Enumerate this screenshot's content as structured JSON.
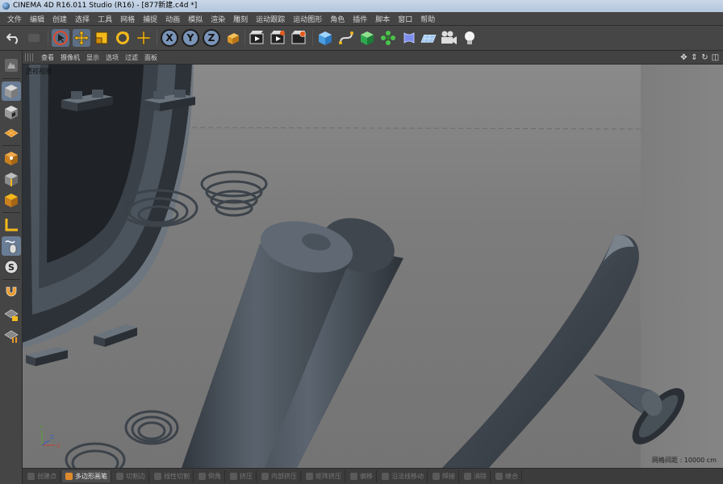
{
  "window": {
    "title": "CINEMA 4D R16.011 Studio (R16) - [877新建.c4d *]"
  },
  "menu": [
    "文件",
    "编辑",
    "创建",
    "选择",
    "工具",
    "网格",
    "捕捉",
    "动画",
    "模拟",
    "渲染",
    "雕刻",
    "运动跟踪",
    "运动图形",
    "角色",
    "插件",
    "脚本",
    "窗口",
    "帮助"
  ],
  "toolbar": {
    "icons": [
      "undo-icon",
      "redo-icon",
      "live-select-icon",
      "move-icon",
      "scale-icon",
      "rotate-icon",
      "last-tool-icon",
      "x-axis-lock-icon",
      "y-axis-lock-icon",
      "z-axis-lock-icon",
      "coordinate-system-icon",
      "render-view-icon",
      "render-to-picture-viewer-icon",
      "edit-render-settings-icon",
      "cube-object-icon",
      "spline-icon",
      "nurbs-icon",
      "array-icon",
      "deformer-icon",
      "floor-icon",
      "camera-icon",
      "light-icon"
    ],
    "axis_x": "X",
    "axis_y": "Y",
    "axis_z": "Z"
  },
  "left_tools": [
    "make-editable-icon",
    "model-mode-icon",
    "texture-mode-icon",
    "workplane-icon",
    "points-mode-icon",
    "edges-mode-icon",
    "polygons-mode-icon",
    "enable-axis-icon",
    "tweak-mode-icon",
    "solo-icon",
    "snap-icon",
    "lock-workplane-icon",
    "planar-workplane-icon"
  ],
  "viewport": {
    "menu": [
      "查看",
      "摄像机",
      "显示",
      "选项",
      "过滤",
      "面板"
    ],
    "nav_icons": [
      "pan-icon",
      "dolly-icon",
      "rotate-view-icon",
      "toggle-views-icon"
    ],
    "label": "透视视图",
    "grid_info": "网格间距 : 10000 cm",
    "axis_labels": {
      "x": "X",
      "y": "Y",
      "z": "Z"
    }
  },
  "bottom_tools": [
    {
      "label": "创建点",
      "active": false
    },
    {
      "label": "多边形画笔",
      "active": true
    },
    {
      "label": "切割边",
      "active": false
    },
    {
      "label": "线性切割",
      "active": false
    },
    {
      "label": "倒角",
      "active": false
    },
    {
      "label": "挤压",
      "active": false
    },
    {
      "label": "内部挤压",
      "active": false
    },
    {
      "label": "矩阵挤压",
      "active": false
    },
    {
      "label": "偏移",
      "active": false
    },
    {
      "label": "沿法线移动",
      "active": false
    },
    {
      "label": "焊接",
      "active": false
    },
    {
      "label": "消除",
      "active": false
    },
    {
      "label": "缝合",
      "active": false
    }
  ],
  "colors": {
    "accent": "#6a7d96",
    "viewport_bg": "#7c7c7c",
    "model": "#4a525c",
    "active_tool": "#e08a2e"
  }
}
